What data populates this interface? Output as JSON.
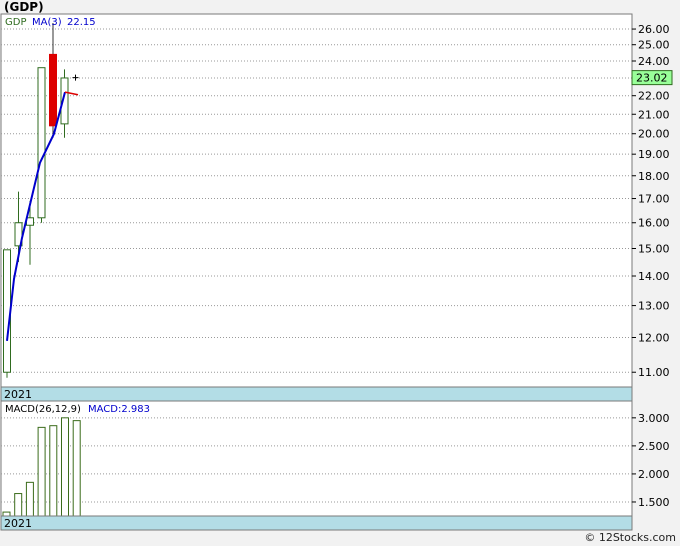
{
  "title": "(GDP)",
  "credit": "© 12Stocks.com",
  "colors": {
    "up_candle": "#2f6b1f",
    "down_candle": "#dd0000",
    "ma_line": "#0000cc",
    "macd_bar": "#3a6b1a",
    "price_tag_bg": "#99ff99",
    "date_band": "#b3dde6",
    "grid": "#999999"
  },
  "chart_data": [
    {
      "type": "candlestick",
      "legend": {
        "ticker": "GDP",
        "ma_label": "MA(3)",
        "ma_value": "22.15"
      },
      "x_label": "2021",
      "ylim": [
        10.6,
        27.0
      ],
      "y_scale": "log",
      "y_ticks": [
        "11.00",
        "12.00",
        "13.00",
        "14.00",
        "15.00",
        "16.00",
        "17.00",
        "18.00",
        "19.00",
        "20.00",
        "21.00",
        "22.00",
        "23.00",
        "24.00",
        "25.00",
        "26.00"
      ],
      "last_price": "23.02",
      "candles": [
        {
          "open": 11.0,
          "close": 14.95,
          "high": 14.95,
          "low": 10.85
        },
        {
          "open": 15.1,
          "close": 16.0,
          "high": 17.3,
          "low": 14.5
        },
        {
          "open": 15.9,
          "close": 16.2,
          "high": 16.9,
          "low": 14.4
        },
        {
          "open": 16.2,
          "close": 23.6,
          "high": 23.6,
          "low": 16.0
        },
        {
          "open": 24.4,
          "close": 20.4,
          "high": 26.4,
          "low": 19.8
        },
        {
          "open": 20.5,
          "close": 23.0,
          "high": 23.5,
          "low": 19.8
        }
      ],
      "last_tick": {
        "price": 23.02
      },
      "ma_values": [
        11.9,
        13.9,
        15.4,
        18.6,
        20.0,
        22.2,
        22.15
      ],
      "ma_tail": [
        22.2,
        22.05
      ]
    },
    {
      "type": "bar",
      "legend": {
        "label": "MACD(26,12,9)",
        "value_label": "MACD:2.983"
      },
      "x_label": "2021",
      "ylim": [
        1.25,
        3.3
      ],
      "y_ticks": [
        "1.500",
        "2.000",
        "2.500",
        "3.000"
      ],
      "values": [
        1.32,
        1.65,
        1.85,
        2.83,
        2.86,
        3.0,
        2.95
      ]
    }
  ]
}
